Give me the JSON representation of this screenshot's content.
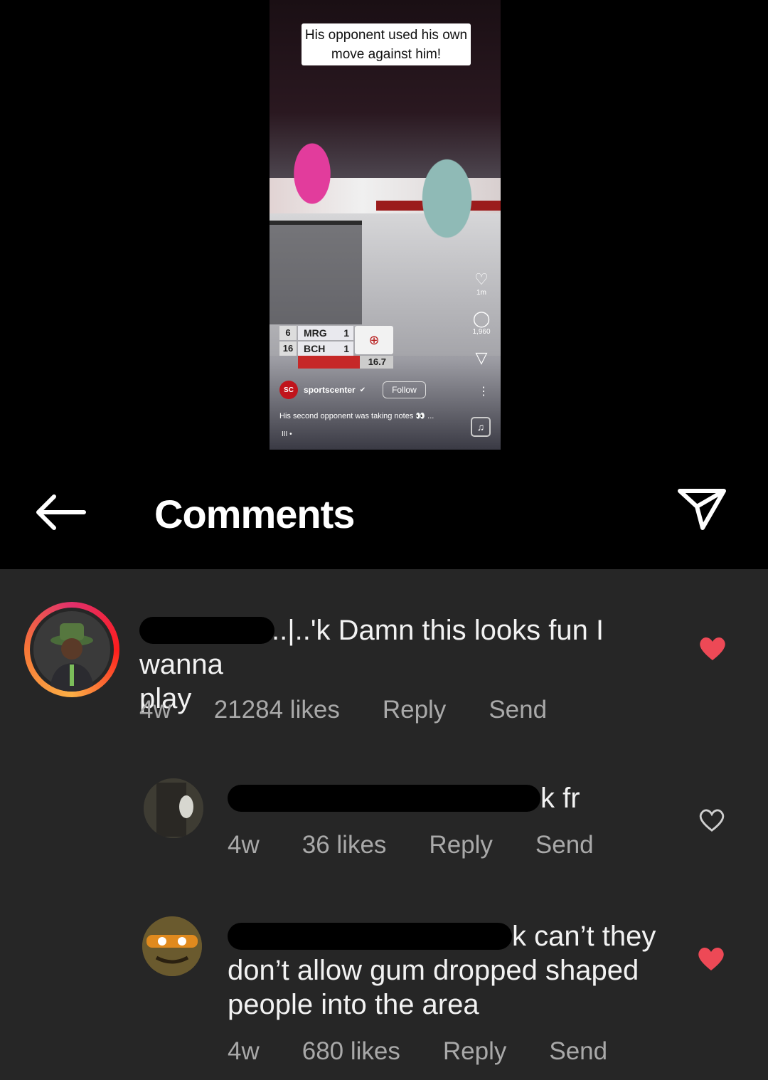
{
  "reel": {
    "caption_overlay": "His opponent used his own move against him!",
    "scoreboard": {
      "team_a": "MRG",
      "team_a_score": "1",
      "team_b": "BCH",
      "team_b_score": "1",
      "left_top": "6",
      "left_bottom": "16",
      "clock": "16.7",
      "logo_icon": "globe-logo-icon"
    },
    "likes": "1m",
    "comments_count": "1,960",
    "username": "sportscenter",
    "account_logo": "SC",
    "follow_label": "Follow",
    "description": "His second opponent was taking notes 👀 ...",
    "audio_indicator": "III •"
  },
  "header": {
    "title": "Comments",
    "back_icon": "arrow-left-icon",
    "share_icon": "paper-plane-icon"
  },
  "comments": [
    {
      "visible_username_fragment": "..|..'k",
      "text_line1": "Damn this looks fun I wanna",
      "text_line2": "play",
      "age": "4w",
      "likes": "21284 likes",
      "reply_label": "Reply",
      "send_label": "Send",
      "liked": true,
      "has_story_ring": true
    },
    {
      "visible_username_fragment": "k",
      "text_line1": "fr",
      "age": "4w",
      "likes": "36 likes",
      "reply_label": "Reply",
      "send_label": "Send",
      "liked": false
    },
    {
      "visible_username_fragment": "k",
      "text_line1": "can’t they",
      "text_line2": "don’t allow gum dropped shaped",
      "text_line3": "people into the area",
      "age": "4w",
      "likes": "680 likes",
      "reply_label": "Reply",
      "send_label": "Send",
      "liked": true
    }
  ],
  "colors": {
    "background_top": "#000000",
    "comments_bg": "#262626",
    "liked_heart": "#ed4956",
    "meta_text": "#a9a9a9"
  }
}
